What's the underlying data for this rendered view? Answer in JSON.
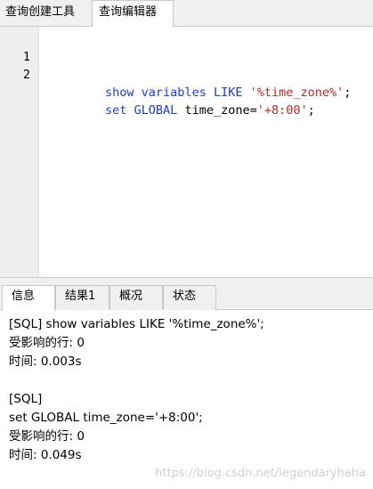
{
  "top_tabs": [
    {
      "label": "查询创建工具",
      "active": false
    },
    {
      "label": "查询编辑器",
      "active": true
    }
  ],
  "editor": {
    "lines": [
      {
        "number": "1",
        "tokens": [
          {
            "text": "show variables LIKE ",
            "kind": "kw"
          },
          {
            "text": "'%time_zone%'",
            "kind": "str"
          },
          {
            "text": ";",
            "kind": "plain"
          }
        ]
      },
      {
        "number": "2",
        "tokens": [
          {
            "text": "set GLOBAL ",
            "kind": "kw"
          },
          {
            "text": "time_zone=",
            "kind": "plain"
          },
          {
            "text": "'+8:00'",
            "kind": "str"
          },
          {
            "text": ";",
            "kind": "plain"
          }
        ]
      }
    ],
    "colors": {
      "keyword": "#1f3bd0",
      "string": "#b02a2a",
      "plain": "#000000"
    }
  },
  "result_tabs": [
    {
      "label": "信息",
      "active": true
    },
    {
      "label": "结果1",
      "active": false
    },
    {
      "label": "概况",
      "active": false
    },
    {
      "label": "状态",
      "active": false
    }
  ],
  "messages": [
    "[SQL] show variables LIKE '%time_zone%';",
    "受影响的行: 0",
    "时间: 0.003s",
    "",
    "[SQL]",
    "set GLOBAL time_zone='+8:00';",
    "受影响的行: 0",
    "时间: 0.049s"
  ],
  "watermark": "https://blog.csdn.net/legendaryhaha"
}
